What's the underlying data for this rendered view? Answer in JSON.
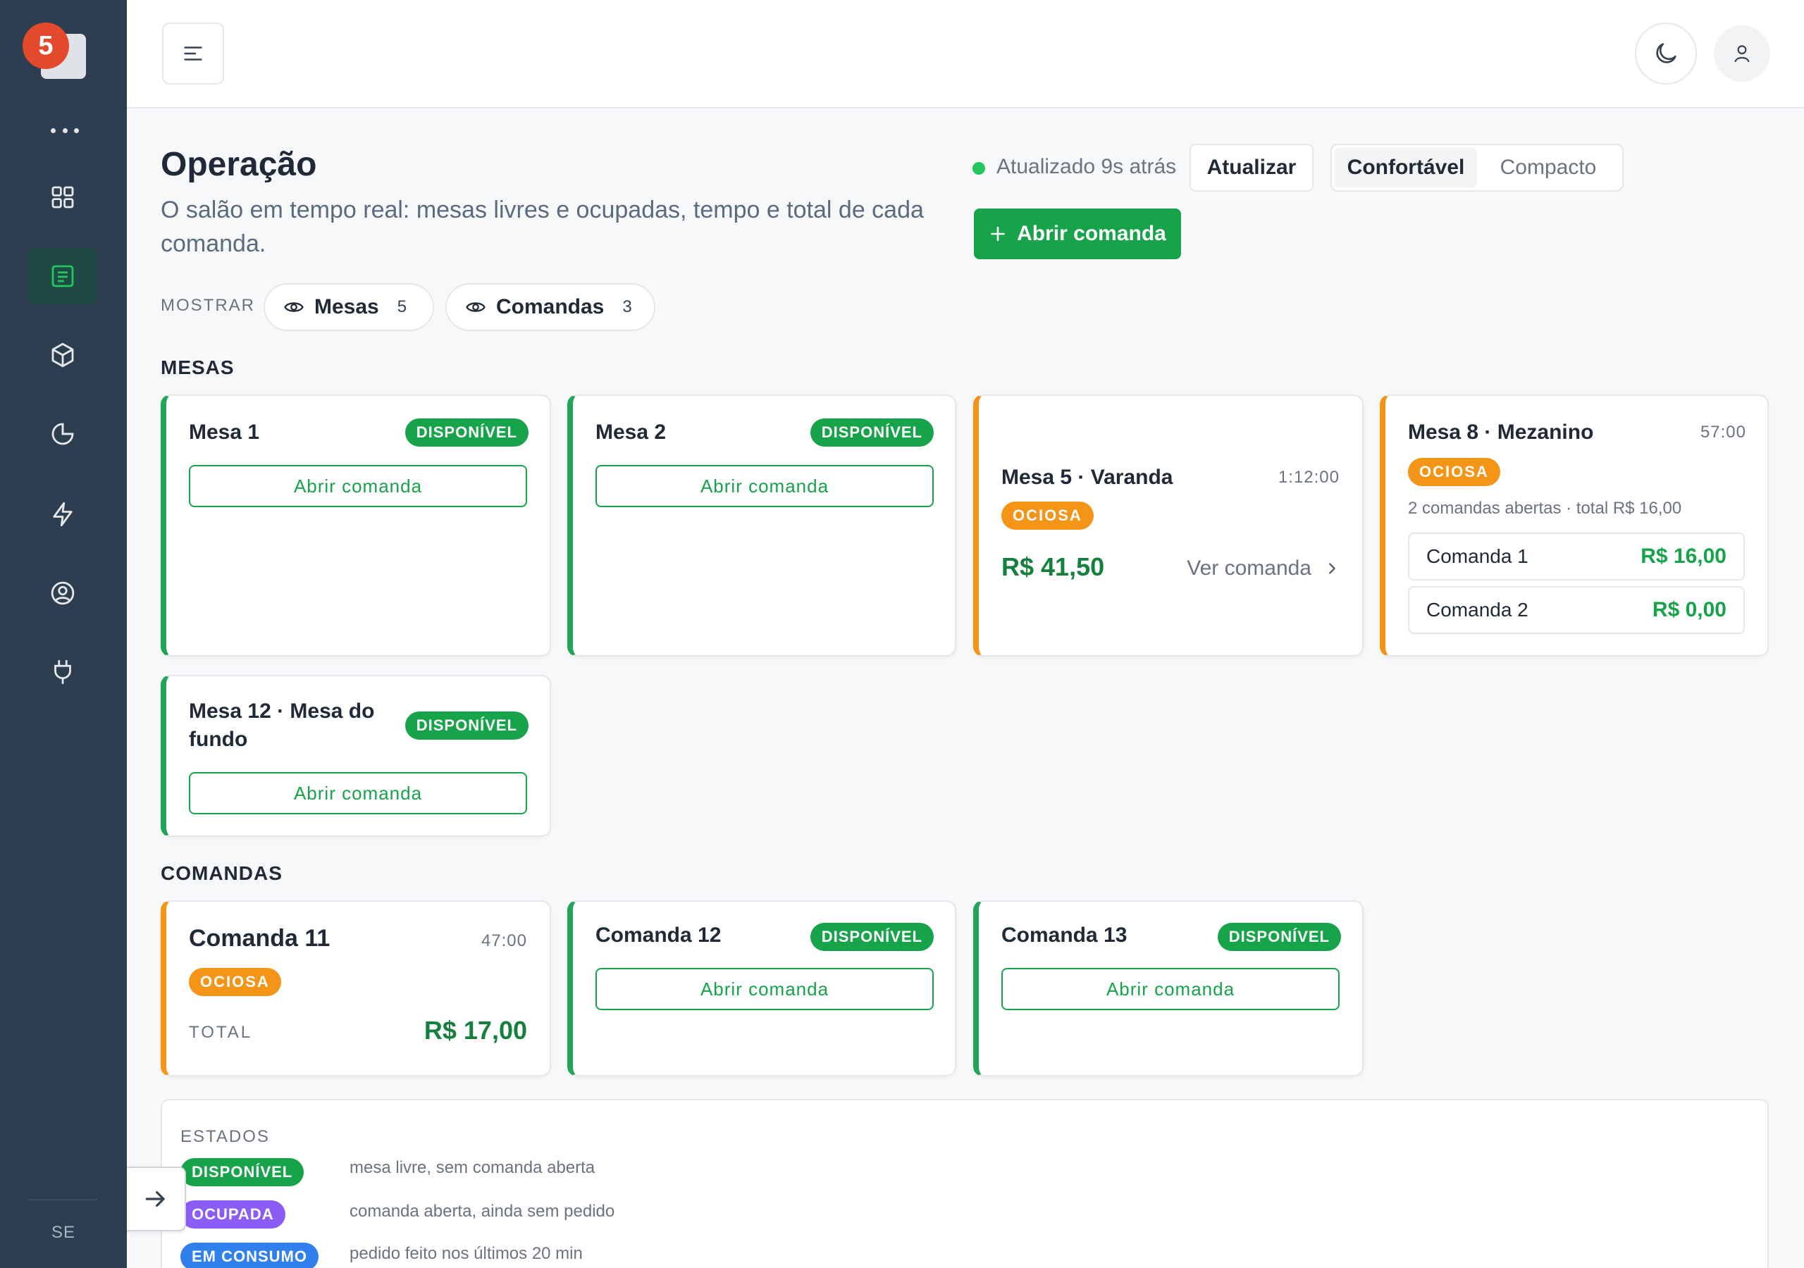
{
  "sidebar": {
    "badge_count": "5",
    "footer_label": "SE",
    "items": [
      {
        "icon": "grid-icon"
      },
      {
        "icon": "list-icon",
        "active": true
      },
      {
        "icon": "box-icon"
      },
      {
        "icon": "pie-chart-icon"
      },
      {
        "icon": "lightning-icon"
      },
      {
        "icon": "user-circle-icon"
      },
      {
        "icon": "plug-icon"
      }
    ]
  },
  "header": {
    "title": "Operação",
    "subtitle": "O salão em tempo real: mesas livres e ocupadas, tempo e total de cada comanda.",
    "status": "Atualizado 9s atrás",
    "refresh_label": "Atualizar",
    "density_options": [
      "Confortável",
      "Compacto"
    ],
    "density_selected": "Confortável",
    "open_button": "Abrir comanda"
  },
  "filters": {
    "label": "MOSTRAR",
    "chips": [
      {
        "label": "Mesas",
        "count": "5"
      },
      {
        "label": "Comandas",
        "count": "3"
      }
    ]
  },
  "sections": {
    "mesas": "MESAS",
    "comandas": "COMANDAS"
  },
  "mesas": [
    {
      "title": "Mesa 1",
      "badge": "DISPONÍVEL",
      "action": "Abrir comanda"
    },
    {
      "title": "Mesa 2",
      "badge": "DISPONÍVEL",
      "action": "Abrir comanda"
    },
    {
      "title": "Mesa 5 · Varanda",
      "time": "1:12:00",
      "badge": "OCIOSA",
      "total": "R$ 41,50",
      "link": "Ver comanda"
    },
    {
      "title": "Mesa 8 · Mezanino",
      "time": "57:00",
      "badge": "OCIOSA",
      "meta": "2 comandas abertas · total R$ 16,00",
      "comandas": [
        {
          "name": "Comanda 1",
          "value": "R$ 16,00"
        },
        {
          "name": "Comanda 2",
          "value": "R$ 0,00"
        }
      ]
    },
    {
      "title_line1": "Mesa 12 · Mesa do",
      "title_line2": "fundo",
      "badge": "DISPONÍVEL",
      "action": "Abrir comanda"
    }
  ],
  "comandas": [
    {
      "title": "Comanda 11",
      "time": "47:00",
      "badge": "OCIOSA",
      "total_label": "TOTAL",
      "total": "R$ 17,00"
    },
    {
      "title": "Comanda 12",
      "badge": "DISPONÍVEL",
      "action": "Abrir comanda"
    },
    {
      "title": "Comanda 13",
      "badge": "DISPONÍVEL",
      "action": "Abrir comanda"
    }
  ],
  "legend": {
    "title": "ESTADOS",
    "items": [
      {
        "badge": "DISPONÍVEL",
        "text": "mesa livre, sem comanda aberta",
        "color": "#16a34a"
      },
      {
        "badge": "OCUPADA",
        "text": "comanda aberta, ainda sem pedido",
        "color": "#8b5cf6"
      },
      {
        "badge": "EM CONSUMO",
        "text": "pedido feito nos últimos 20 min",
        "color": "#2f80ed"
      }
    ]
  },
  "colors": {
    "accent": "#16a34a",
    "idle": "#f59518",
    "sidebar": "#2c3e50"
  }
}
